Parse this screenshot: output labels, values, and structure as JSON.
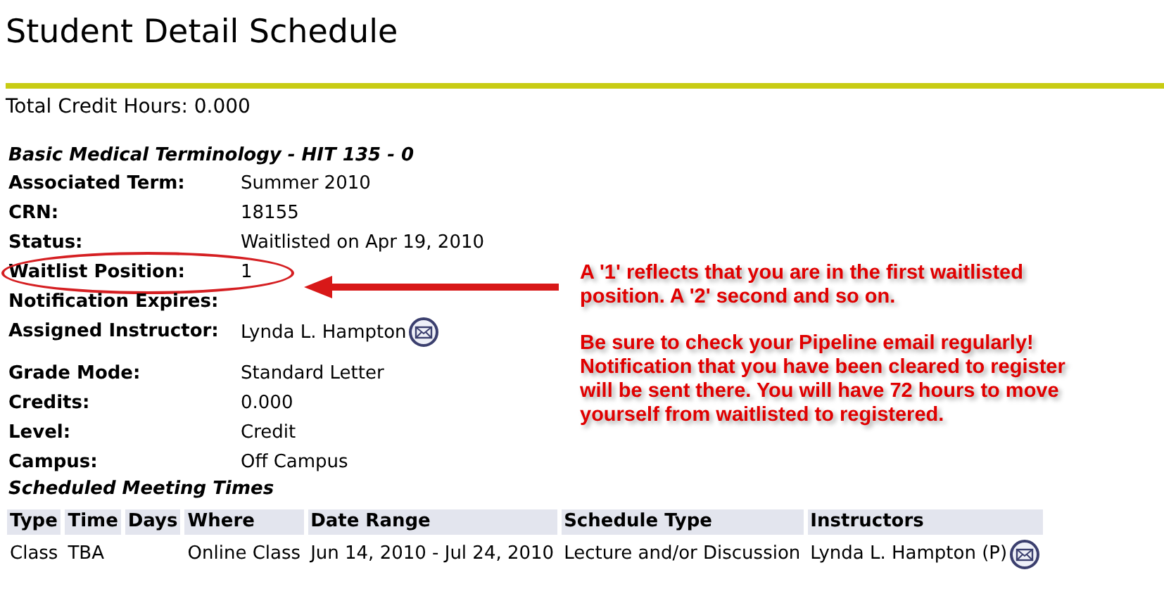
{
  "title": "Student Detail Schedule",
  "total_credit_hours": "Total Credit Hours: 0.000",
  "course": {
    "title": "Basic Medical Terminology - HIT 135 - 0",
    "fields": [
      {
        "label": "Associated Term:",
        "value": "Summer 2010",
        "kind": "text",
        "highlighted": false
      },
      {
        "label": "CRN:",
        "value": "18155",
        "kind": "text",
        "highlighted": false
      },
      {
        "label": "Status:",
        "value": "Waitlisted on Apr 19, 2010",
        "kind": "text",
        "highlighted": false
      },
      {
        "label": "Waitlist Position:",
        "value": "1",
        "kind": "text",
        "highlighted": true
      },
      {
        "label": "Notification Expires:",
        "kind": "text",
        "highlighted": false
      },
      {
        "label": "Assigned Instructor:",
        "value": "Lynda L. Hampton",
        "kind": "contact",
        "highlighted": false
      },
      {
        "label": "Grade Mode:",
        "value": "Standard Letter",
        "kind": "text",
        "highlighted": false
      },
      {
        "label": "Credits:",
        "value": "0.000",
        "kind": "text",
        "highlighted": false
      },
      {
        "label": "Level:",
        "value": "Credit",
        "kind": "text",
        "highlighted": false
      },
      {
        "label": "Campus:",
        "value": "Off Campus",
        "kind": "text",
        "highlighted": false
      }
    ]
  },
  "meeting_times": {
    "title": "Scheduled Meeting Times",
    "columns": [
      "Type",
      "Time",
      "Days",
      "Where",
      "Date Range",
      "Schedule Type",
      "Instructors"
    ],
    "rows": [
      {
        "cells": [
          {
            "kind": "text",
            "text": "Class"
          },
          {
            "kind": "text",
            "text": "TBA"
          },
          {
            "kind": "empty"
          },
          {
            "kind": "text",
            "text": "Online Class"
          },
          {
            "kind": "text",
            "text": "Jun 14, 2010 - Jul 24, 2010"
          },
          {
            "kind": "text",
            "text": "Lecture and/or Discussion"
          },
          {
            "kind": "contact",
            "text": "Lynda L. Hampton (P)"
          }
        ]
      }
    ]
  },
  "annotation": {
    "paragraphs": [
      "A '1' reflects that you are in the first waitlisted position. A '2' second and so on.",
      "Be sure to check your Pipeline email regularly! Notification that you have been cleared to register will be sent there. You will have 72 hours to move yourself from waitlisted to registered."
    ]
  }
}
